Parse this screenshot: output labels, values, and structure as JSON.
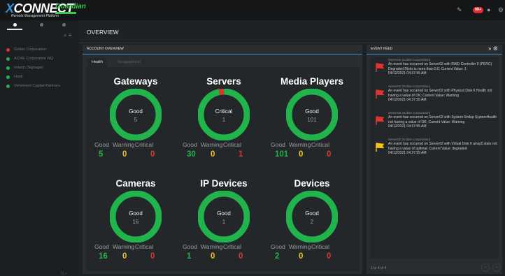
{
  "app": {
    "logo_main": "CONNECT",
    "logo_x": "X",
    "logo_sub": "Guardian",
    "logo_tagline": "Remote Management Platform",
    "notifications_count": "99+"
  },
  "sidebar": {
    "sites": [
      {
        "label": "Golbin Corporation",
        "status_color": "#e0352d"
      },
      {
        "label": "ACME Corporation HQ",
        "status_color": "#21b34c"
      },
      {
        "label": "Initech (Signage)",
        "status_color": "#21b34c"
      },
      {
        "label": "Hooli",
        "status_color": "#21b34c"
      },
      {
        "label": "Vehement Capital Partners",
        "status_color": "#21b34c"
      }
    ]
  },
  "page": {
    "title": "OVERVIEW"
  },
  "overview": {
    "header": "ACCOUNT OVERVIEW",
    "tabs": [
      "Health",
      "Geographical"
    ],
    "stat_labels": {
      "good": "Good",
      "warning": "Warning",
      "critical": "Critical"
    },
    "tiles": [
      {
        "title": "Gateways",
        "status": "Good",
        "total": 5,
        "good": 5,
        "warning": 0,
        "critical": 0
      },
      {
        "title": "Servers",
        "status": "Critical",
        "total": 1,
        "good": 30,
        "warning": 0,
        "critical": 1
      },
      {
        "title": "Media Players",
        "status": "Good",
        "total": 101,
        "good": 101,
        "warning": 0,
        "critical": 0
      },
      {
        "title": "Cameras",
        "status": "Good",
        "total": 16,
        "good": 16,
        "warning": 0,
        "critical": 0
      },
      {
        "title": "IP Devices",
        "status": "Good",
        "total": 1,
        "good": 1,
        "warning": 0,
        "critical": 0
      },
      {
        "title": "Devices",
        "status": "Good",
        "total": 2,
        "good": 2,
        "warning": 0,
        "critical": 0
      }
    ]
  },
  "feed": {
    "header": "EVENT FEED",
    "events": [
      {
        "source": "Server02 (Golbin Corporation)",
        "flag": "red",
        "message": "An event has occurred on Server02 with RAID Controller 0 (PERC) Degraded Disks is more than 0.0; Current Value: 1",
        "time": "04/12/2021 04:37:55 AM"
      },
      {
        "source": "Server02 (Golbin Corporation)",
        "flag": "red",
        "message": "An event has occurred on Server02 with Physical Disk 6 Health not having a value of OK; Current Value: Warning",
        "time": "04/12/2021 04:37:55 AM"
      },
      {
        "source": "Server02 (Golbin Corporation)",
        "flag": "red",
        "message": "An event has occurred on Server02 with System Rollup SystemHealth not having a value of OK; Current Value: Warning",
        "time": "04/12/2021 04:37:55 AM"
      },
      {
        "source": "Server02 (Golbin Corporation)",
        "flag": "yellow",
        "message": "An event has occurred on Server02 with Virtual Disk 0 array5 state not having a value of optimal; Current Value: degraded",
        "time": "04/12/2021 04:37:55 AM"
      }
    ],
    "footer": "1 to 4 of 4"
  },
  "colors": {
    "good": "#21b34c",
    "warning": "#f2c216",
    "critical": "#e0352d",
    "accent": "#3a8fd6"
  }
}
